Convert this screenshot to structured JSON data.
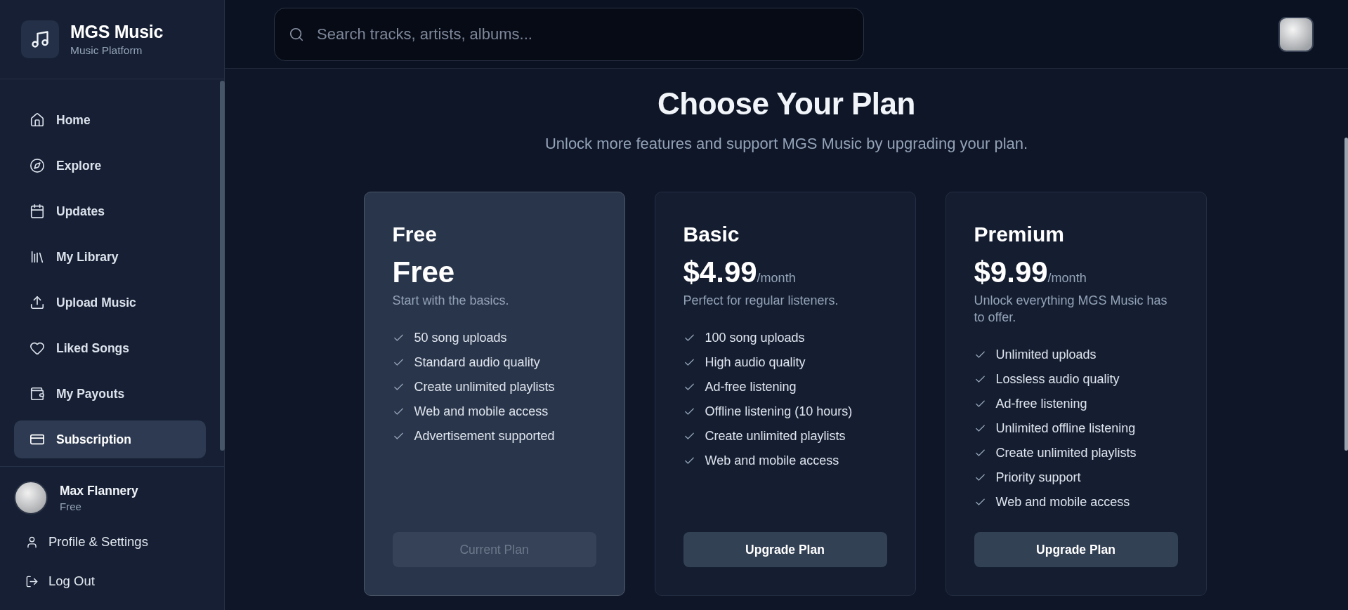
{
  "sidebar": {
    "brand": {
      "title": "MGS Music",
      "subtitle": "Music Platform"
    },
    "nav_items": [
      {
        "label": "Home",
        "selected": false
      },
      {
        "label": "Explore",
        "selected": false
      },
      {
        "label": "Updates",
        "selected": false
      },
      {
        "label": "My Library",
        "selected": false
      },
      {
        "label": "Upload Music",
        "selected": false
      },
      {
        "label": "Liked Songs",
        "selected": false
      },
      {
        "label": "My Payouts",
        "selected": false
      },
      {
        "label": "Subscription",
        "selected": true
      }
    ],
    "user": {
      "name": "Max Flannery",
      "plan": "Free"
    },
    "account_links": [
      {
        "label": "Profile & Settings"
      },
      {
        "label": "Log Out"
      }
    ]
  },
  "topbar": {
    "search": {
      "placeholder": "Search tracks, artists, albums..."
    }
  },
  "page": {
    "title": "Choose Your Plan",
    "subtitle": "Unlock more features and support MGS Music by upgrading your plan."
  },
  "plans": [
    {
      "name": "Free",
      "price": "Free",
      "description": "Start with the basics.",
      "current": true,
      "features": [
        "50 song uploads",
        "Standard audio quality",
        "Create unlimited playlists",
        "Web and mobile access",
        "Advertisement supported"
      ],
      "button": {
        "label": "Current Plan",
        "disabled": true
      }
    },
    {
      "name": "Basic",
      "price": "$4.99",
      "period": "/month",
      "description": "Perfect for regular listeners.",
      "current": false,
      "features": [
        "100 song uploads",
        "High audio quality",
        "Ad-free listening",
        "Offline listening (10 hours)",
        "Create unlimited playlists",
        "Web and mobile access"
      ],
      "button": {
        "label": "Upgrade Plan",
        "disabled": false
      }
    },
    {
      "name": "Premium",
      "price": "$9.99",
      "period": "/month",
      "description": "Unlock everything MGS Music has to offer.",
      "current": false,
      "features": [
        "Unlimited uploads",
        "Lossless audio quality",
        "Ad-free listening",
        "Unlimited offline listening",
        "Create unlimited playlists",
        "Priority support",
        "Web and mobile access"
      ],
      "button": {
        "label": "Upgrade Plan",
        "disabled": false
      }
    }
  ]
}
